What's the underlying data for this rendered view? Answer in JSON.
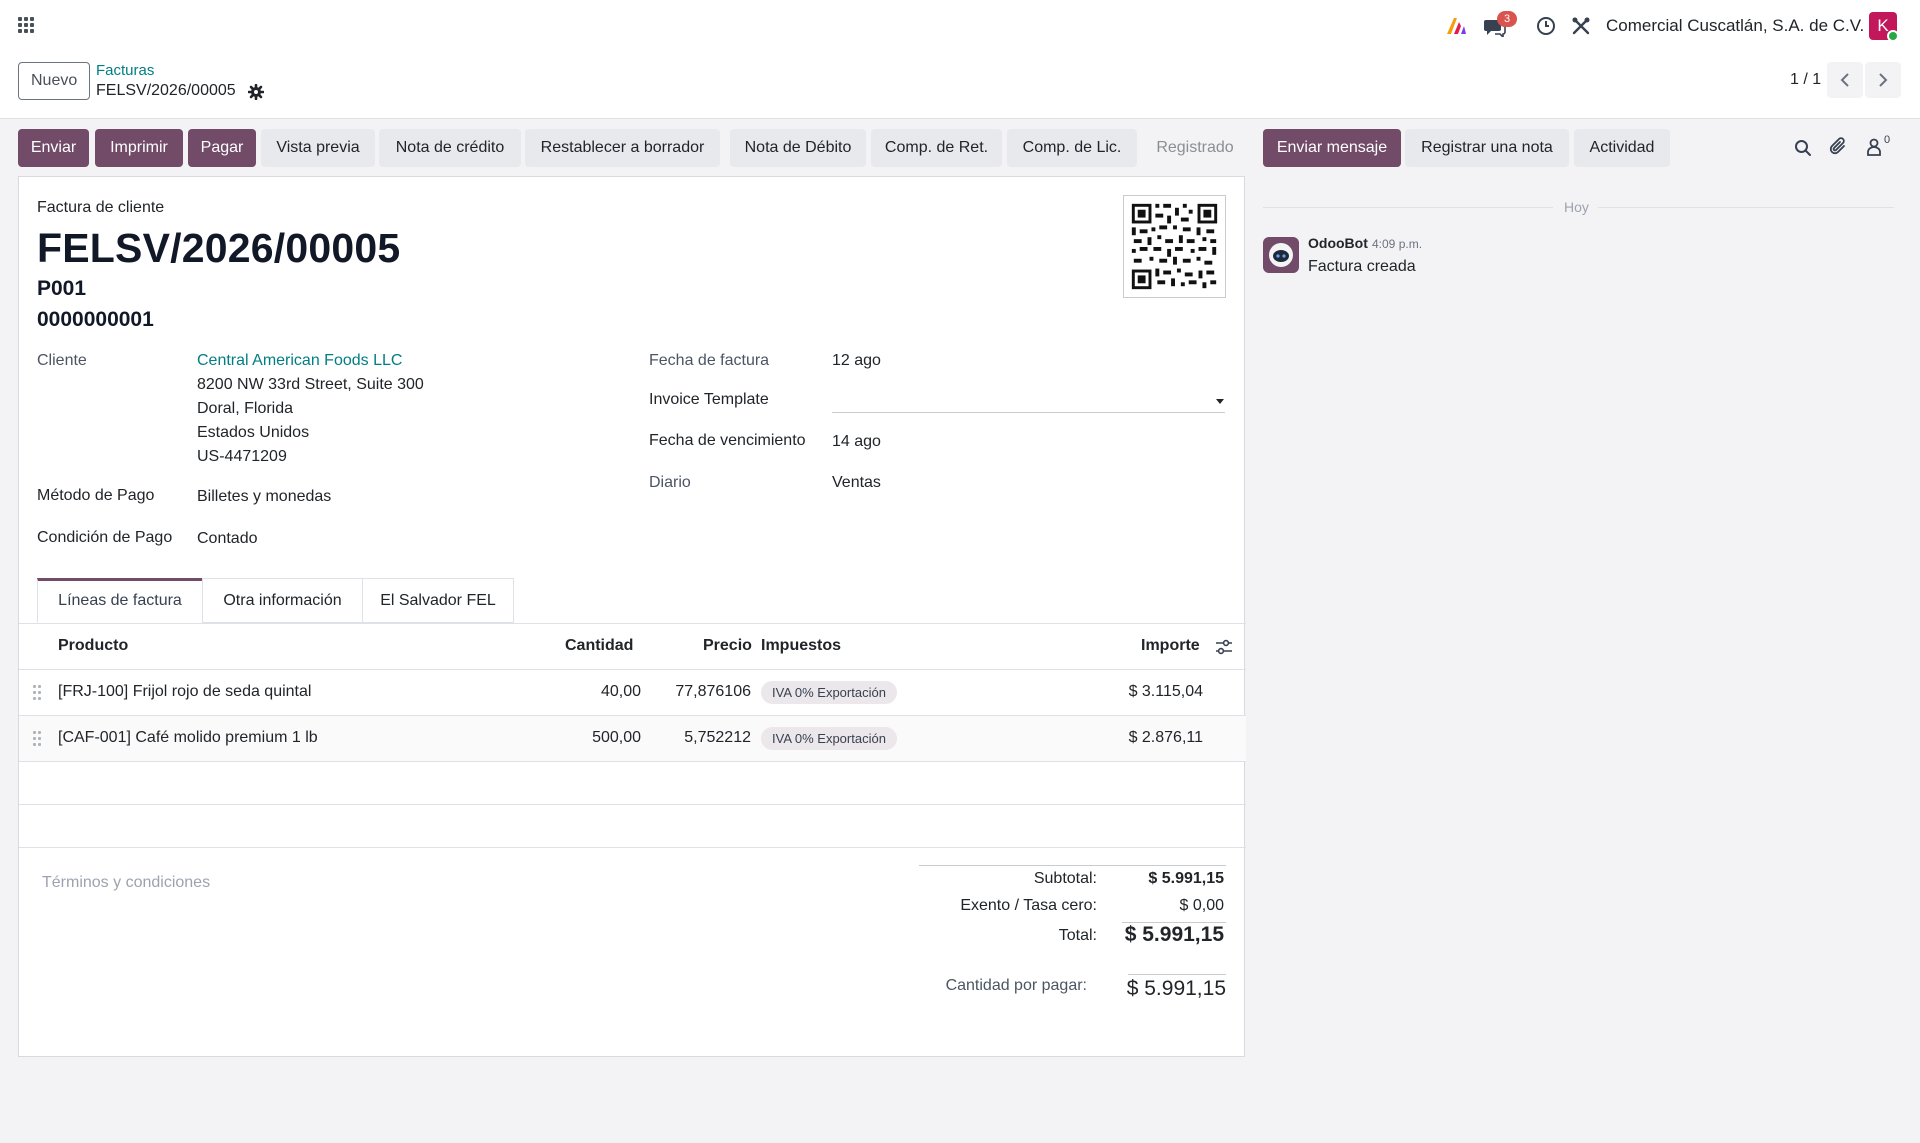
{
  "navbar": {
    "notification_count": "3",
    "company": "Comercial Cuscatlán, S.A. de C.V.",
    "avatar_initial": "K",
    "icons": [
      "apps-grid-icon",
      "ai-icon",
      "messages-icon",
      "clock-icon",
      "tools-icon"
    ]
  },
  "control": {
    "new_label": "Nuevo",
    "breadcrumb_parent": "Facturas",
    "breadcrumb_current": "FELSV/2026/00005",
    "pager": "1 / 1"
  },
  "actions": {
    "send": "Enviar",
    "print": "Imprimir",
    "pay": "Pagar",
    "preview": "Vista previa",
    "credit_note": "Nota de crédito",
    "reset_draft": "Restablecer a borrador",
    "debit_note": "Nota de Débito",
    "comp_ret": "Comp. de Ret.",
    "comp_lic": "Comp. de Lic.",
    "status": "Registrado"
  },
  "form": {
    "doc_type": "Factura de cliente",
    "number": "FELSV/2026/00005",
    "series": "P001",
    "correlative": "0000000001",
    "customer_label": "Cliente",
    "customer_name": "Central American Foods LLC",
    "customer_address": [
      "8200 NW 33rd Street, Suite 300",
      "Doral, Florida",
      "Estados Unidos",
      "US-4471209"
    ],
    "payment_method_label": "Método de Pago",
    "payment_method": "Billetes y monedas",
    "payment_condition_label": "Condición de Pago",
    "payment_condition": "Contado",
    "invoice_date_label": "Fecha de factura",
    "invoice_date": "12 ago",
    "template_label": "Invoice Template",
    "due_date_label": "Fecha de vencimiento",
    "due_date": "14 ago",
    "journal_label": "Diario",
    "journal": "Ventas"
  },
  "tabs": [
    {
      "label": "Líneas de factura"
    },
    {
      "label": "Otra información"
    },
    {
      "label": "El Salvador FEL"
    }
  ],
  "table": {
    "headers": {
      "product": "Producto",
      "qty": "Cantidad",
      "price": "Precio",
      "taxes": "Impuestos",
      "amount": "Importe"
    },
    "rows": [
      {
        "product": "[FRJ-100] Frijol rojo de seda quintal",
        "qty": "40,00",
        "price": "77,876106",
        "tax": "IVA 0% Exportación",
        "amount": "$ 3.115,04"
      },
      {
        "product": "[CAF-001] Café molido premium 1 lb",
        "qty": "500,00",
        "price": "5,752212",
        "tax": "IVA 0% Exportación",
        "amount": "$ 2.876,11"
      }
    ]
  },
  "totals": {
    "terms_placeholder": "Términos y condiciones",
    "subtotal_label": "Subtotal:",
    "subtotal": "$ 5.991,15",
    "exempt_label": "Exento / Tasa cero:",
    "exempt": "$ 0,00",
    "total_label": "Total:",
    "total": "$ 5.991,15",
    "due_label": "Cantidad por pagar:",
    "due": "$ 5.991,15"
  },
  "chatter": {
    "send_message": "Enviar mensaje",
    "log_note": "Registrar una nota",
    "activity": "Actividad",
    "followers_count": "0",
    "today": "Hoy",
    "author": "OdooBot",
    "time": "4:09 p.m.",
    "message": "Factura creada"
  },
  "colors": {
    "primary": "#714b67",
    "link": "#017e84",
    "badge": "#d9534f"
  }
}
